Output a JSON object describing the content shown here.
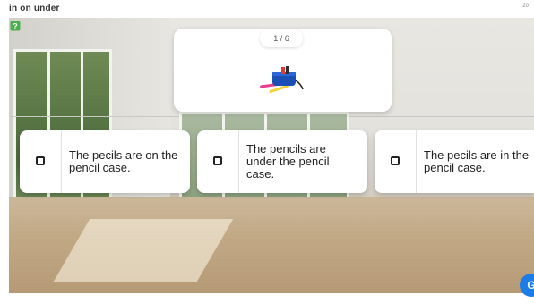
{
  "header": {
    "title": "in on under",
    "corner_text": "20"
  },
  "question": {
    "counter": "1 / 6",
    "image_icon": "pencil-case-icon"
  },
  "answers": [
    {
      "label": "The pecils are on the pencil case."
    },
    {
      "label": "The pencils are under the pencil case."
    },
    {
      "label": "The pecils are in the pencil case."
    }
  ],
  "help_icon": "help-icon",
  "fab_icon": "chat-icon",
  "colors": {
    "accent": "#1d7de6",
    "card": "#ffffff",
    "text": "#222222"
  }
}
